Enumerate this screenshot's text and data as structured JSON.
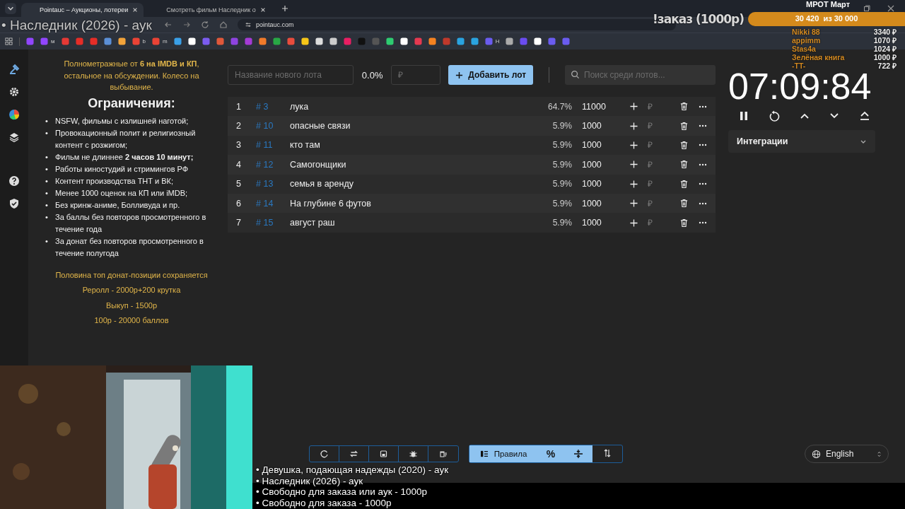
{
  "browser": {
    "tabs": [
      {
        "title": "Pointauc – Аукционы, лотереи",
        "selected": true
      },
      {
        "title": "Смотреть фильм Наследник о",
        "selected": false
      }
    ],
    "address": "pointauc.com",
    "bookmarks": [
      {
        "label": "м"
      },
      {
        "label": "b"
      },
      {
        "label": "m"
      },
      {
        "label": "Н"
      }
    ]
  },
  "overlay": {
    "now_playing": "• Наследник (2026) - аук",
    "order_label": "!заказ (1000р)",
    "goal": {
      "title": "МРОТ Март",
      "text": "30 420  из 30 000",
      "level": 1.0
    },
    "donors": [
      {
        "name": "Nikki 88",
        "amount": "3340 ₽"
      },
      {
        "name": "appimm",
        "amount": "1070 ₽"
      },
      {
        "name": "Stas4a",
        "amount": "1024 ₽"
      },
      {
        "name": "Зелёная книга",
        "amount": "1000 ₽"
      },
      {
        "name": "-TT-",
        "amount": "722 ₽"
      }
    ],
    "queue": [
      "• Девушка, подающая надежды (2020) - аук",
      "• Наследник (2026) - аук",
      "• Свободно для заказа или аук - 1000р",
      "• Свободно для заказа - 1000р"
    ]
  },
  "rules": {
    "intro": "Полнометражные от **6 на IMDB и КП**, остальное на обсуждении. Колесо на выбывание.",
    "heading": "Ограничения:",
    "items": [
      {
        "bullet": "•",
        "text": "NSFW, фильмы с излишней наготой;"
      },
      {
        "bullet": "•",
        "text": "Провокационный полит и религиозный контент с розжигом;"
      },
      {
        "bullet": "•",
        "text": "Фильм не длиннее **2 часов 10 минут;**"
      },
      {
        "bullet": "•",
        "text": "Работы киностудий и стримингов РФ"
      },
      {
        "bullet": "•",
        "text": "Контент производства ТНТ и ВК;"
      },
      {
        "bullet": "•",
        "text": "Менее 1000 оценок на КП или iMDB;"
      },
      {
        "bullet": "•",
        "text": "Без кринж-аниме, Болливуда и пр."
      },
      {
        "bullet": "•",
        "text": "За баллы без повторов просмотренного в течение года"
      },
      {
        "bullet": "•",
        "text": "За донат без повторов просмотренного в течение полугода"
      }
    ],
    "footer": [
      "Половина топ донат-позиции сохраняется",
      "Реролл - 2000р+200 крутка",
      "Выкуп - 1500р",
      "100р - 20000 баллов"
    ]
  },
  "lot_form": {
    "name_placeholder": "Название нового лота",
    "percent": "0.0%",
    "amount_placeholder": "₽",
    "add_button": "Добавить лот",
    "search_placeholder": "Поиск среди лотов..."
  },
  "lots": [
    {
      "index": "1",
      "id": "# 3",
      "name": "лука",
      "percent": "64.7%",
      "amount": "11000",
      "add_placeholder": "₽"
    },
    {
      "index": "2",
      "id": "# 10",
      "name": "опасные связи",
      "percent": "5.9%",
      "amount": "1000",
      "add_placeholder": "₽"
    },
    {
      "index": "3",
      "id": "# 11",
      "name": "кто там",
      "percent": "5.9%",
      "amount": "1000",
      "add_placeholder": "₽"
    },
    {
      "index": "4",
      "id": "# 12",
      "name": "Самогонщики",
      "percent": "5.9%",
      "amount": "1000",
      "add_placeholder": "₽"
    },
    {
      "index": "5",
      "id": "# 13",
      "name": "семья в аренду",
      "percent": "5.9%",
      "amount": "1000",
      "add_placeholder": "₽"
    },
    {
      "index": "6",
      "id": "# 14",
      "name": "На глубине 6 футов",
      "percent": "5.9%",
      "amount": "1000",
      "add_placeholder": "₽"
    },
    {
      "index": "7",
      "id": "# 15",
      "name": "август раш",
      "percent": "5.9%",
      "amount": "1000",
      "add_placeholder": "₽"
    }
  ],
  "timer": {
    "time": "07:09:84"
  },
  "integrations": {
    "title": "Интеграции",
    "expanded": false
  },
  "toolbar": {
    "rules_button": "Правила",
    "percent_button": "%",
    "language": "English"
  }
}
